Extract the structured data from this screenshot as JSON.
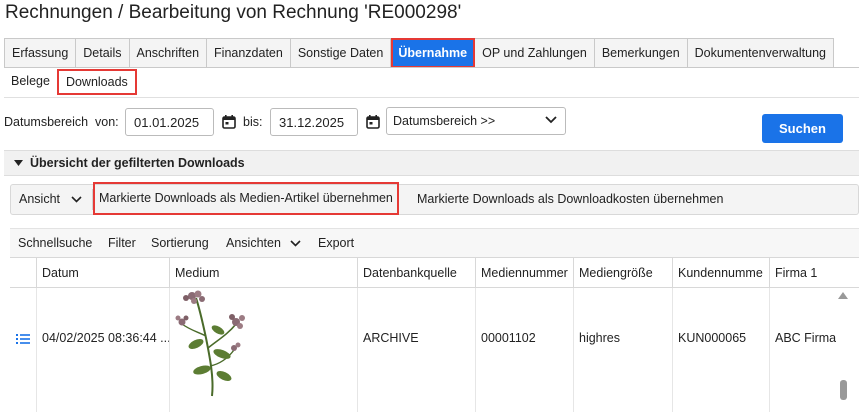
{
  "header": {
    "title": "Rechnungen / Bearbeitung von Rechnung 'RE000298'"
  },
  "tabs": [
    {
      "label": "Erfassung"
    },
    {
      "label": "Details"
    },
    {
      "label": "Anschriften"
    },
    {
      "label": "Finanzdaten"
    },
    {
      "label": "Sonstige Daten"
    },
    {
      "label": "Übernahme",
      "active": true
    },
    {
      "label": "OP und Zahlungen"
    },
    {
      "label": "Bemerkungen"
    },
    {
      "label": "Dokumentenverwaltung"
    }
  ],
  "subtabs": [
    {
      "label": "Belege"
    },
    {
      "label": "Downloads",
      "active": true
    }
  ],
  "filter": {
    "range_label": "Datumsbereich",
    "from_label": "von:",
    "from_value": "01.01.2025",
    "to_label": "bis:",
    "to_value": "31.12.2025",
    "range_select": "Datumsbereich >>",
    "search_label": "Suchen"
  },
  "section": {
    "title": "Übersicht der gefilterten Downloads"
  },
  "actions": {
    "view_label": "Ansicht",
    "media_label": "Markierte Downloads als Medien-Artikel übernehmen",
    "cost_label": "Markierte Downloads als Downloadkosten übernehmen"
  },
  "grid_toolbar": {
    "quicksearch": "Schnellsuche",
    "filter": "Filter",
    "sort": "Sortierung",
    "views": "Ansichten",
    "export": "Export"
  },
  "table": {
    "columns": [
      "Datum",
      "Medium",
      "Datenbankquelle",
      "Mediennummer",
      "Mediengröße",
      "Kundennumme",
      "Firma 1"
    ],
    "rows": [
      {
        "datum": "04/02/2025 08:36:44 ...",
        "medium": "flower-image",
        "quelle": "ARCHIVE",
        "nummer": "00001102",
        "groesse": "highres",
        "kunde": "KUN000065",
        "firma": "ABC Firma"
      }
    ]
  },
  "colors": {
    "accent": "#1a73e8",
    "highlight": "#e53935"
  }
}
